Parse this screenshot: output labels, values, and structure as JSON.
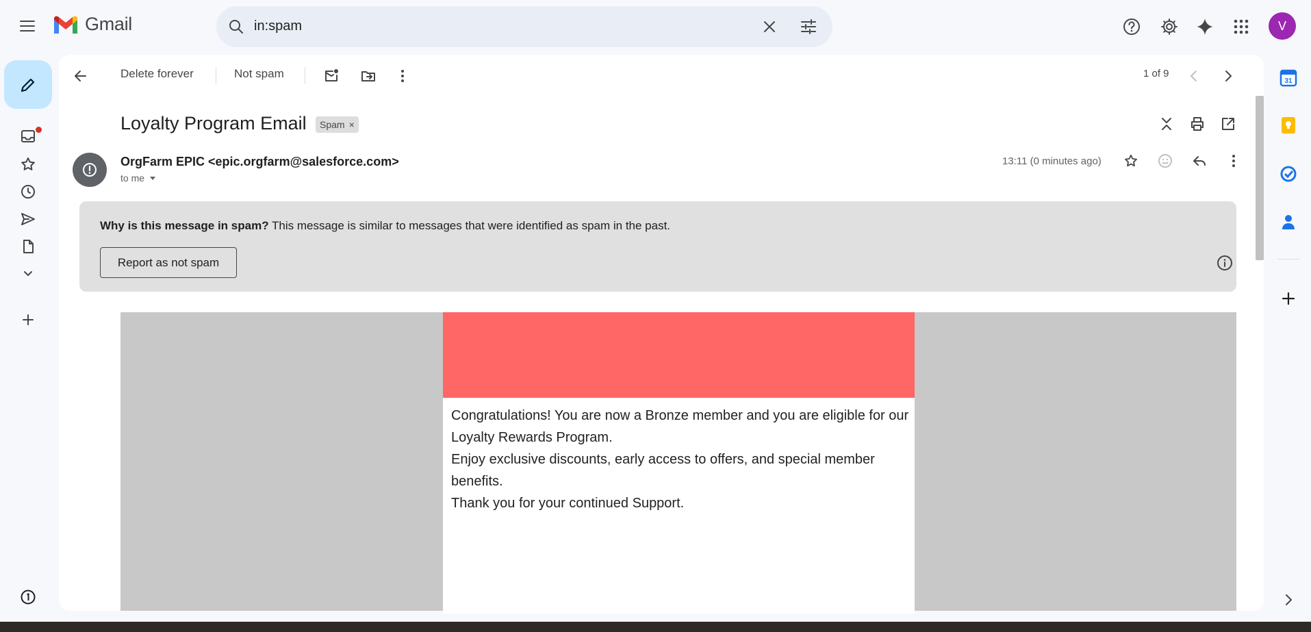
{
  "app": {
    "name": "Gmail"
  },
  "search": {
    "query": "in:spam"
  },
  "toolbar": {
    "delete_forever": "Delete forever",
    "not_spam": "Not spam",
    "pager": "1 of 9"
  },
  "message": {
    "subject": "Loyalty Program Email",
    "label_chip": "Spam",
    "sender": "OrgFarm EPIC <epic.orgfarm@salesforce.com>",
    "recipient": "to me",
    "time": "13:11 (0 minutes ago)"
  },
  "spam_notice": {
    "title": "Why is this message in spam?",
    "text": " This message is similar to messages that were identified as spam in the past.",
    "report_button": "Report as not spam"
  },
  "email_body": {
    "banner_color": "#ff6666",
    "line1": "Congratulations! You are now a Bronze member and you are eligible for our Loyalty Rewards Program.",
    "line2": "Enjoy exclusive discounts, early access to offers, and special member benefits.",
    "line3": "Thank you for your continued Support."
  },
  "user": {
    "avatar_letter": "V",
    "avatar_color": "#9c27b0"
  },
  "colors": {
    "compose_bg": "#c2e7ff",
    "unread_dot": "#d93025"
  }
}
